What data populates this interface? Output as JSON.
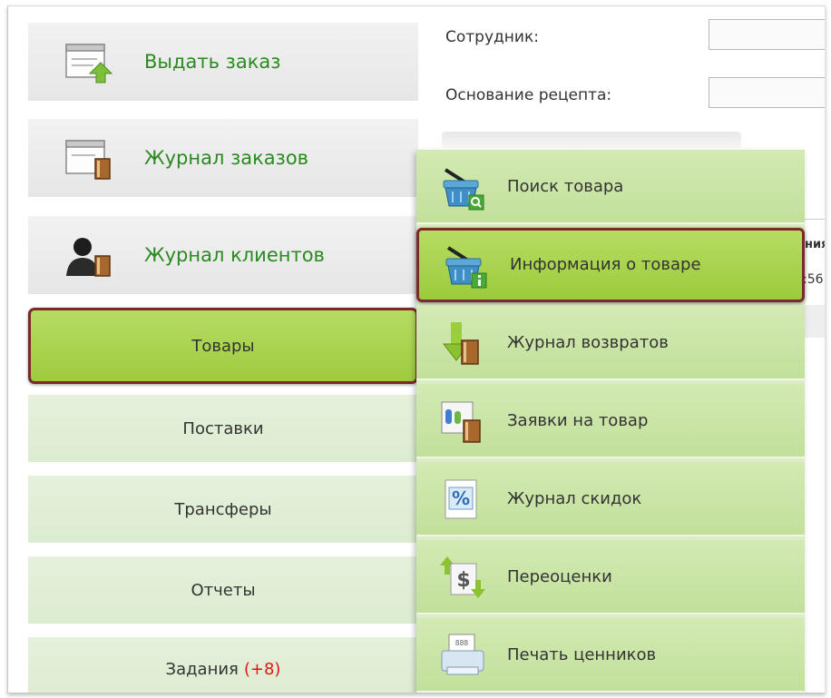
{
  "menu": {
    "big_items": [
      {
        "label": "Выдать заказ",
        "icon": "document-arrow-icon"
      },
      {
        "label": "Журнал заказов",
        "icon": "document-book-icon"
      },
      {
        "label": "Журнал клиентов",
        "icon": "person-book-icon"
      }
    ],
    "flat_items": [
      {
        "label": "Товары",
        "active": true
      },
      {
        "label": "Поставки"
      },
      {
        "label": "Трансферы"
      },
      {
        "label": "Отчеты"
      },
      {
        "label": "Задания",
        "badge": "(+8)"
      }
    ]
  },
  "form": {
    "employee_label": "Сотрудник:",
    "prescription_label": "Основание рецепта:"
  },
  "table_peek": {
    "header_fragment": "ния",
    "cell_fragment": ":56"
  },
  "submenu": {
    "items": [
      {
        "label": "Поиск товара",
        "icon": "basket-search-icon"
      },
      {
        "label": "Информация о товаре",
        "icon": "basket-info-icon",
        "active": true
      },
      {
        "label": "Журнал возвратов",
        "icon": "return-book-icon"
      },
      {
        "label": "Заявки на товар",
        "icon": "request-book-icon"
      },
      {
        "label": "Журнал скидок",
        "icon": "percent-icon"
      },
      {
        "label": "Переоценки",
        "icon": "reprice-icon"
      },
      {
        "label": "Печать ценников",
        "icon": "printer-icon"
      }
    ]
  },
  "colors": {
    "accent_green": "#9fcb3f",
    "highlight_border": "#7b2a2a",
    "menu_text_green": "#2a8a1f",
    "badge_red": "#e01515"
  }
}
